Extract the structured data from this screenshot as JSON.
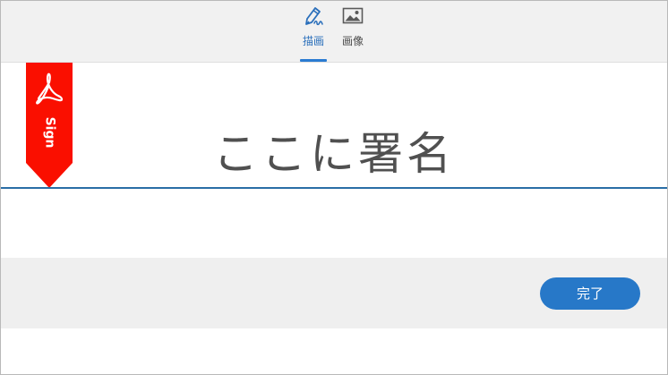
{
  "mode_tabs": [
    {
      "label": "描画",
      "icon": "pen-draw-icon",
      "selected": true
    },
    {
      "label": "画像",
      "icon": "image-icon",
      "selected": false
    }
  ],
  "signature": {
    "placeholder": "ここに署名",
    "ribbon_label": "Sign",
    "ribbon_icon": "adobe-acrobat-icon"
  },
  "footer": {
    "done_label": "完了"
  },
  "colors": {
    "accent": "#2778c8",
    "ribbon": "#fa0f00",
    "baseline": "#2a6ea6"
  }
}
